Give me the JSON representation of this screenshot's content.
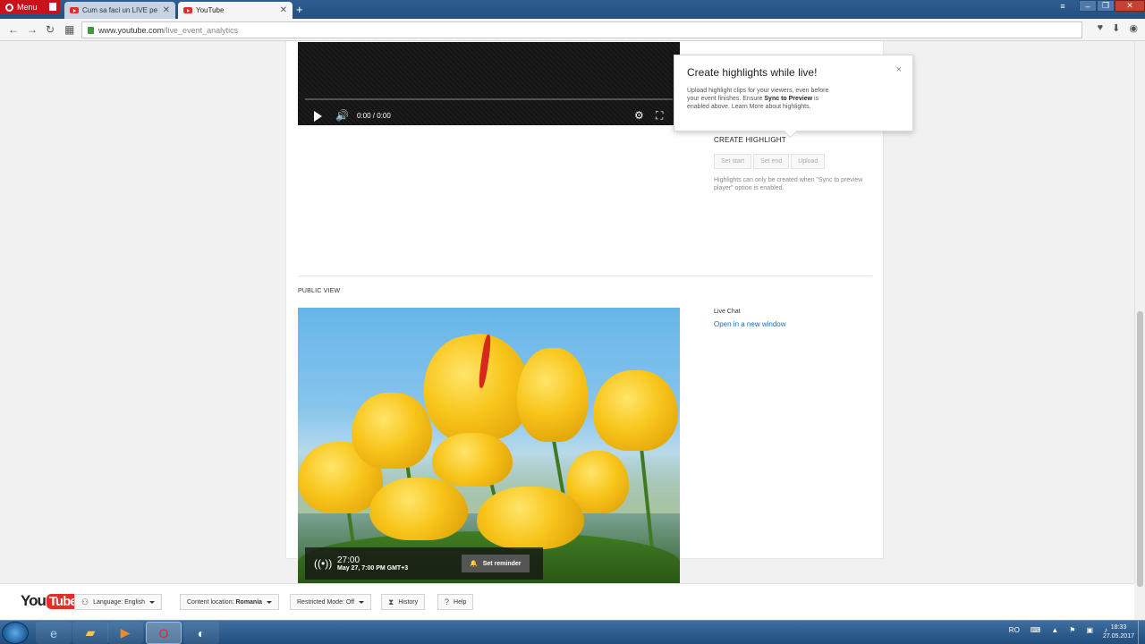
{
  "browser": {
    "menu_label": "Menu",
    "tabs": [
      {
        "title": "Cum sa faci un LIVE pe You",
        "active": false
      },
      {
        "title": "YouTube",
        "active": true
      }
    ],
    "new_tab": "+",
    "url_host": "www.youtube.com",
    "url_path": "/live_event_analytics"
  },
  "top_player": {
    "time": "0:00 / 0:00"
  },
  "tooltip": {
    "title": "Create highlights while live!",
    "body_part1": "Upload highlight clips for your viewers, even before your event finishes. Ensure ",
    "body_bold1": "Sync to Preview",
    "body_part2": " is enabled above. Learn More about highlights.",
    "close": "×"
  },
  "highlight": {
    "title": "CREATE HIGHLIGHT",
    "buttons": [
      "Set start",
      "Set end",
      "Upload"
    ],
    "note": "Highlights can only be created when \"Sync to preview player\" option is enabled."
  },
  "public_view": {
    "label": "PUBLIC VIEW",
    "countdown": "27:00",
    "date": "May 27, 7:00 PM GMT+3",
    "reminder_label": "Set reminder"
  },
  "live_chat": {
    "label": "Live Chat",
    "link": "Open in a new window"
  },
  "footer": {
    "logo_you": "You",
    "logo_tube": "Tube",
    "language": "Language: English",
    "location_prefix": "Content location: ",
    "location_value": "Romania",
    "restricted": "Restricted Mode: Off",
    "history": "History",
    "help": "Help"
  },
  "taskbar": {
    "tray_lang": "RO",
    "clock_time": "18:33",
    "clock_date": "27.05.2017"
  },
  "colors": {
    "youtube_red": "#e52d27",
    "link_blue": "#1a6dbd",
    "opera_red": "#c9121b"
  }
}
